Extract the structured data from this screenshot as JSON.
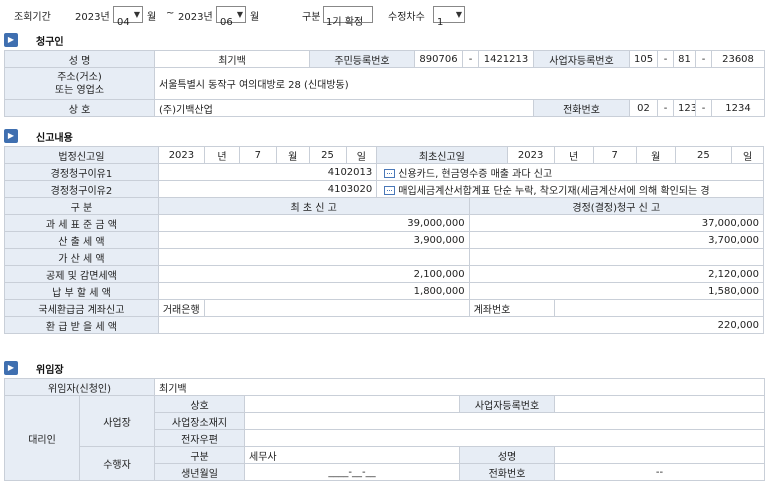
{
  "search": {
    "period_label": "조회기간",
    "from_year": "2023년",
    "from_month": "04",
    "month_label1": "월",
    "tilde": "~",
    "to_year": "2023년",
    "to_month": "06",
    "month_label2": "월",
    "type_label": "구분",
    "type_value": "1기 확정",
    "revision_label": "수정차수",
    "revision_value": "1"
  },
  "claimant": {
    "title": "청구인",
    "name_label": "성 명",
    "name": "최기백",
    "rrn_label": "주민등록번호",
    "rrn1": "890706",
    "rrn_dash": "-",
    "rrn2": "1421213",
    "brn_label": "사업자등록번호",
    "brn1": "105",
    "brn2": "81",
    "brn3": "23608",
    "address_label_1": "주소(거소)",
    "address_label_2": "또는 영업소",
    "address": "서울특별시 동작구 여의대방로 28 (신대방동)",
    "company_label": "상 호",
    "company": "(주)기백산업",
    "phone_label": "전화번호",
    "phone1": "02",
    "phone2": "1234",
    "phone3": "1234"
  },
  "report": {
    "title": "신고내용",
    "legal_date_label": "법정신고일",
    "legal_year": "2023",
    "legal_month": "7",
    "legal_day": "25",
    "year_unit": "년",
    "month_unit": "월",
    "day_unit": "일",
    "first_date_label": "최초신고일",
    "first_year": "2023",
    "first_month": "7",
    "first_day": "25",
    "reason1_label": "경정청구이유1",
    "reason1_code": "4102013",
    "reason1_text": "신용카드, 현금영수증 매출 과다 신고",
    "reason2_label": "경정청구이유2",
    "reason2_code": "4103020",
    "reason2_text": "매입세금계산서합계표 단순 누락, 착오기재(세금계산서에 의해 확인되는 경",
    "col_category": "구          분",
    "col_initial": "최 초 신 고",
    "col_correction": "경정(결정)청구 신 고",
    "rows": [
      {
        "label": "과 세 표 준 금 액",
        "initial": "39,000,000",
        "correction": "37,000,000"
      },
      {
        "label": "산    출    세    액",
        "initial": "3,900,000",
        "correction": "3,700,000"
      },
      {
        "label": "가    산    세    액",
        "initial": "",
        "correction": ""
      },
      {
        "label": "공제 및 감면세액",
        "initial": "2,100,000",
        "correction": "2,120,000"
      },
      {
        "label": "납  부  할  세  액",
        "initial": "1,800,000",
        "correction": "1,580,000"
      }
    ],
    "refund_account_label": "국세환급금 계좌신고",
    "bank_label": "거래은행",
    "account_label": "계좌번호",
    "refund_label": "환 급 받 을 세 액",
    "refund_value": "220,000"
  },
  "delegation": {
    "title": "위임장",
    "delegator_label": "위임자(신청인)",
    "delegator": "최기백",
    "agent_label": "대리인",
    "business_label": "사업장",
    "trade_name_label": "상호",
    "brn_label": "사업자등록번호",
    "location_label": "사업장소재지",
    "email_label": "전자우편",
    "performer_label": "수행자",
    "category_label": "구분",
    "category_value": "세무사",
    "name_label": "성명",
    "birth_label": "생년월일",
    "birth_value": "____-__-__",
    "phone_label": "전화번호",
    "phone_value": "--"
  },
  "colors": {
    "header_bg": "#e7edf5",
    "badge": "#3f6fb0",
    "border": "#c9cfd8"
  }
}
